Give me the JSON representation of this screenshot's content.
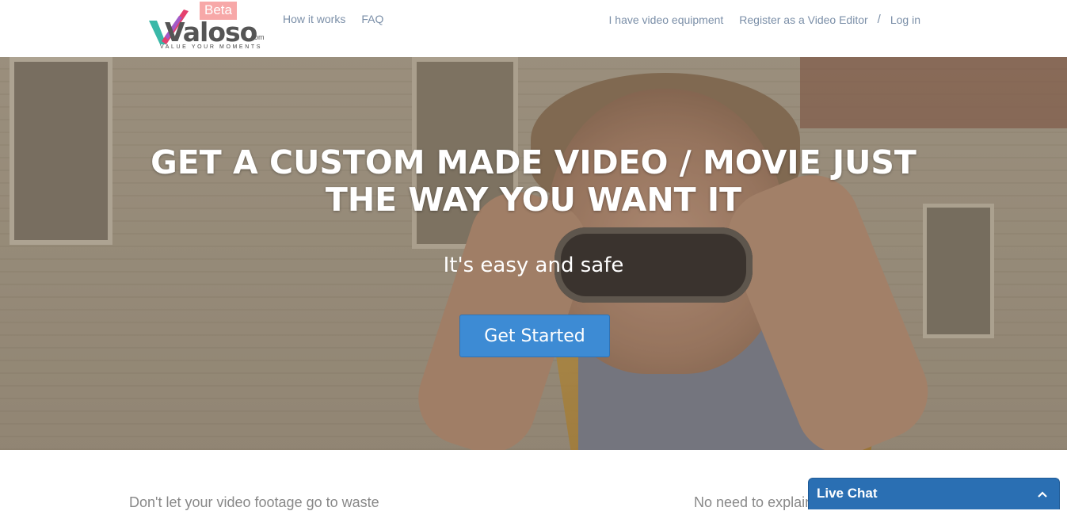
{
  "header": {
    "logo": {
      "word": "Valoso",
      "com": ".com",
      "tagline": "VALUE YOUR MOMENTS",
      "badge": "Beta"
    },
    "nav_left": [
      "How it works",
      "FAQ"
    ],
    "nav_right": {
      "equipment": "I have video equipment",
      "register": "Register as a Video Editor",
      "separator": "/",
      "login": "Log in"
    }
  },
  "hero": {
    "title": "GET A CUSTOM MADE VIDEO / MOVIE JUST THE WAY YOU WANT IT",
    "subtitle": "It's easy and safe",
    "cta": "Get Started"
  },
  "features": {
    "left_heading": "Don't let your video footage go to waste",
    "right_heading": "No need to explain"
  },
  "live_chat": {
    "label": "Live Chat"
  },
  "colors": {
    "cta": "#3d8bd4",
    "nav_link": "#7b8fa8",
    "live_chat": "#2a6fb3",
    "beta_badge": "#f7a8a8"
  }
}
